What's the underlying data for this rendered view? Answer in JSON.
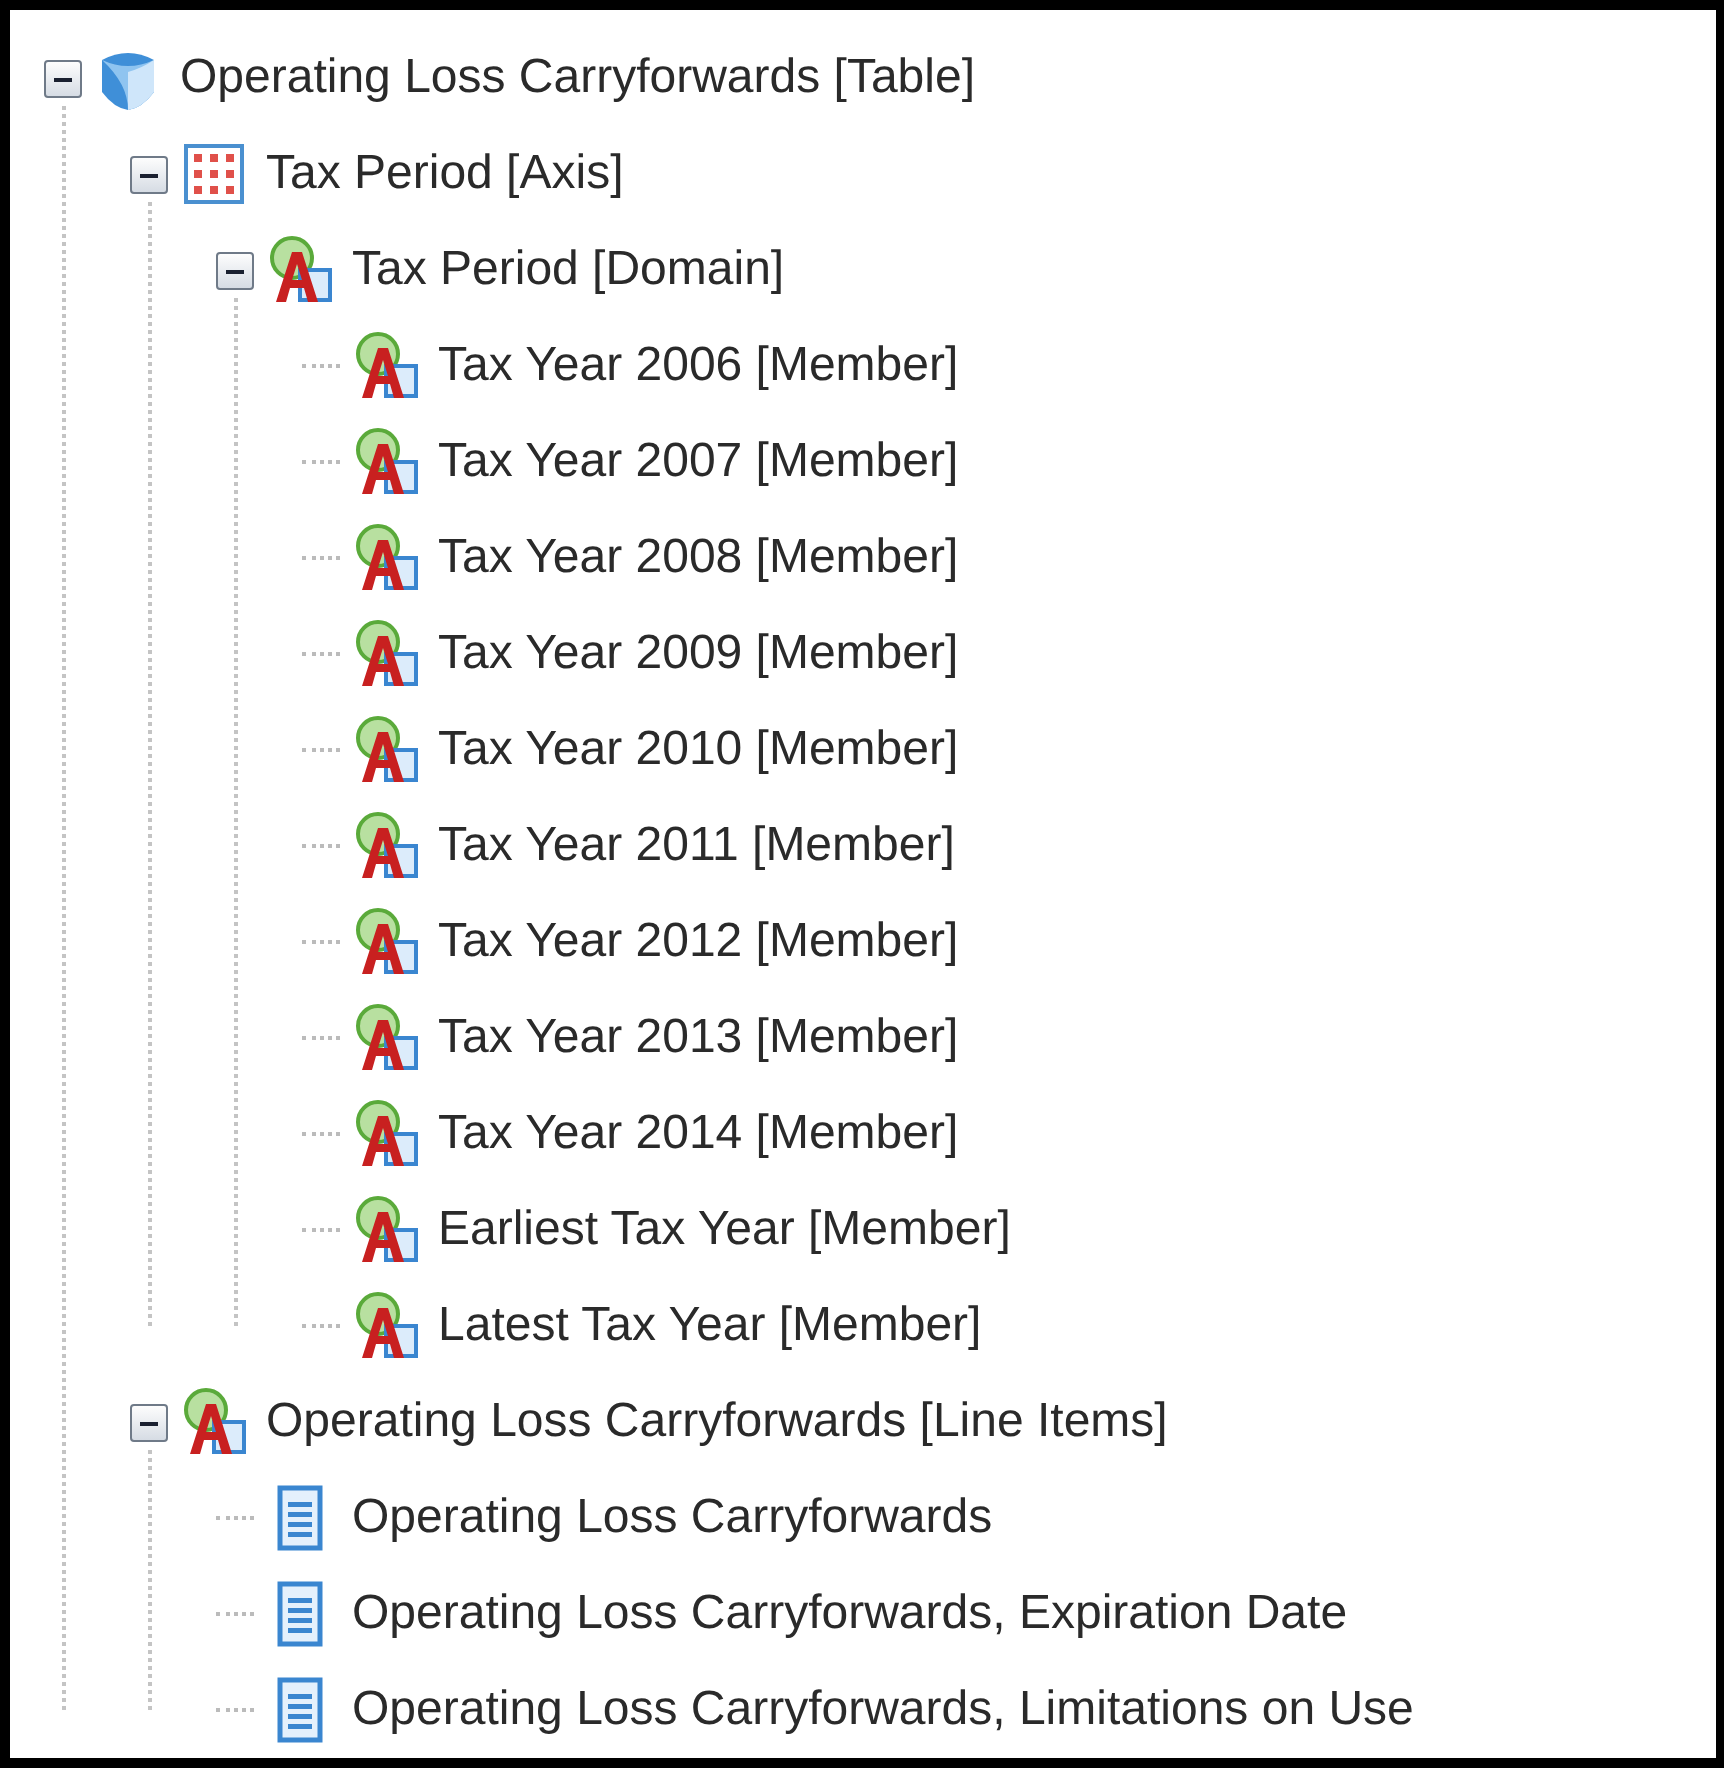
{
  "tree": [
    {
      "label": "Operating Loss Carryforwards [Table]",
      "kind": "table",
      "expanded": true,
      "children": [
        {
          "label": "Tax Period [Axis]",
          "kind": "axis",
          "expanded": true,
          "children": [
            {
              "label": "Tax Period [Domain]",
              "kind": "member",
              "expanded": true,
              "children": [
                {
                  "label": "Tax Year 2006 [Member]",
                  "kind": "member"
                },
                {
                  "label": "Tax Year 2007 [Member]",
                  "kind": "member"
                },
                {
                  "label": "Tax Year 2008 [Member]",
                  "kind": "member"
                },
                {
                  "label": "Tax Year 2009 [Member]",
                  "kind": "member"
                },
                {
                  "label": "Tax Year 2010 [Member]",
                  "kind": "member"
                },
                {
                  "label": "Tax Year 2011 [Member]",
                  "kind": "member"
                },
                {
                  "label": "Tax Year 2012 [Member]",
                  "kind": "member"
                },
                {
                  "label": "Tax Year 2013 [Member]",
                  "kind": "member"
                },
                {
                  "label": "Tax Year 2014 [Member]",
                  "kind": "member"
                },
                {
                  "label": "Earliest Tax Year [Member]",
                  "kind": "member"
                },
                {
                  "label": "Latest Tax Year [Member]",
                  "kind": "member"
                }
              ]
            }
          ]
        },
        {
          "label": "Operating Loss Carryforwards [Line Items]",
          "kind": "member",
          "expanded": true,
          "children": [
            {
              "label": "Operating Loss Carryforwards",
              "kind": "concept"
            },
            {
              "label": "Operating Loss Carryforwards, Expiration Date",
              "kind": "concept"
            },
            {
              "label": "Operating Loss Carryforwards, Limitations on Use",
              "kind": "concept"
            }
          ]
        }
      ]
    }
  ]
}
